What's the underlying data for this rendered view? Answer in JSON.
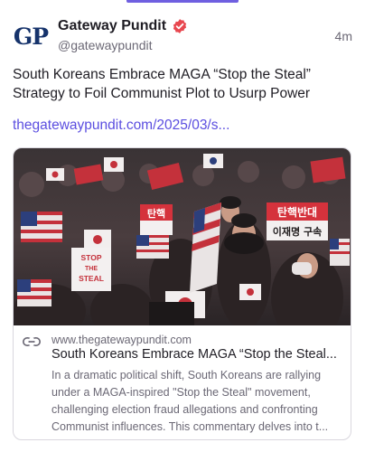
{
  "post": {
    "author": {
      "display_name": "Gateway Pundit",
      "handle": "@gatewaypundit",
      "avatar_text": "GP",
      "verified_icon": "verified-badge-icon"
    },
    "timestamp": "4m",
    "text": "South Koreans Embrace MAGA “Stop the Steal” Strategy to Foil Communist Plot to Usurp Power",
    "link_text": "thegatewaypundit.com/2025/03/s...",
    "link_card": {
      "icon": "link-icon",
      "domain": "www.thegatewaypundit.com",
      "title": "South Koreans Embrace MAGA “Stop the Steal...",
      "description": "In a dramatic political shift, South Koreans are rallying under a MAGA-inspired \"Stop the Steal\" movement, challenging election fraud allegations and confronting Communist influences. This commentary delves into t...",
      "image_signs": {
        "sign_1": "STOP THE STEAL",
        "sign_2": "탄핵반대",
        "sign_3": "이재명 구속",
        "sign_4": "탄핵"
      }
    }
  },
  "colors": {
    "accent": "#6f5fe0",
    "link": "#5b4ee0",
    "verified": "#e8474f",
    "avatar_text": "#16336b"
  }
}
